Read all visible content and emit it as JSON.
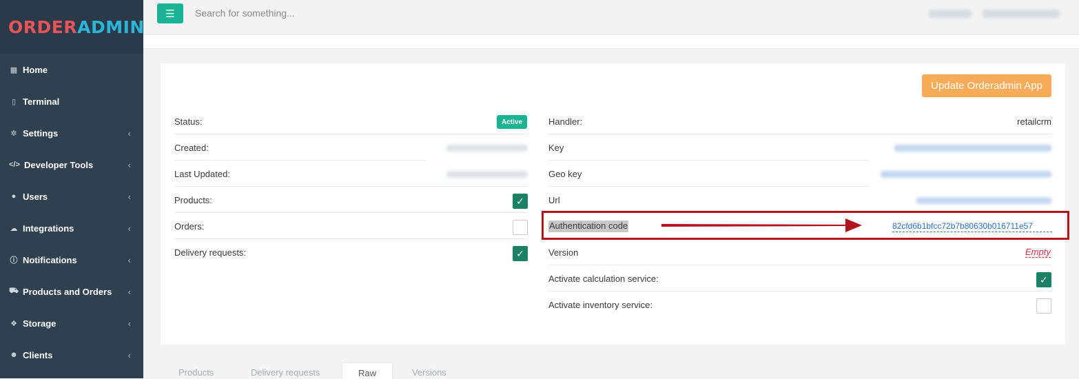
{
  "app": {
    "logo_part1": "ORDER",
    "logo_part2": "ADMIN"
  },
  "topbar": {
    "menu_icon": "hamburger-icon",
    "search_placeholder": "Search for something..."
  },
  "sidebar": {
    "items": [
      {
        "label": "Home",
        "icon": "grid-icon",
        "has_submenu": false
      },
      {
        "label": "Terminal",
        "icon": "tablet-icon",
        "has_submenu": false
      },
      {
        "label": "Settings",
        "icon": "gear-icon",
        "has_submenu": true
      },
      {
        "label": "Developer Tools",
        "icon": "code-icon",
        "has_submenu": true
      },
      {
        "label": "Users",
        "icon": "user-icon",
        "has_submenu": true
      },
      {
        "label": "Integrations",
        "icon": "cloud-icon",
        "has_submenu": true
      },
      {
        "label": "Notifications",
        "icon": "info-icon",
        "has_submenu": true
      },
      {
        "label": "Products and Orders",
        "icon": "cart-icon",
        "has_submenu": true
      },
      {
        "label": "Storage",
        "icon": "cubes-icon",
        "has_submenu": true
      },
      {
        "label": "Clients",
        "icon": "users-icon",
        "has_submenu": true
      }
    ]
  },
  "main": {
    "update_button": "Update Orderadmin App",
    "left": {
      "status_label": "Status:",
      "status_badge": "Active",
      "created_label": "Created:",
      "last_updated_label": "Last Updated:",
      "products_label": "Products:",
      "products_checked": true,
      "orders_label": "Orders:",
      "orders_checked": false,
      "delivery_label": "Delivery requests:",
      "delivery_checked": true
    },
    "right": {
      "handler_label": "Handler:",
      "handler_value": "retailcrm",
      "key_label": "Key",
      "geo_key_label": "Geo key",
      "url_label": "Url",
      "auth_label": "Authentication code",
      "auth_value": "82cfd6b1bfcc72b7b80630b016711e57",
      "version_label": "Version",
      "version_value": "Empty",
      "calc_label": "Activate calculation service:",
      "calc_checked": true,
      "inventory_label": "Activate inventory service:",
      "inventory_checked": false
    }
  },
  "tabs": [
    "Products",
    "Delivery requests",
    "Raw",
    "Versions"
  ],
  "active_tab": "Raw",
  "colors": {
    "sidebar": "#2f4050",
    "accent": "#1ab394",
    "warning_button": "#f8ac59",
    "annotation_red": "#b3131a"
  }
}
